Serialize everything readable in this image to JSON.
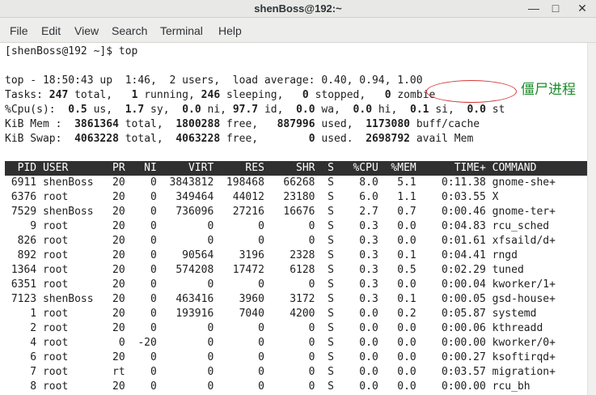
{
  "window": {
    "title": "shenBoss@192:~",
    "controls": {
      "minimize": "—",
      "maximize": "□",
      "close": "✕"
    }
  },
  "menu": [
    "File",
    "Edit",
    "View",
    "Search",
    "Terminal",
    "Help"
  ],
  "terminal": {
    "prompt_line": "[shenBoss@192 ~]$ top",
    "summary": {
      "line1": "top - 18:50:43 up  1:46,  2 users,  load average: 0.40, 0.94, 1.00",
      "tasks": {
        "label": "Tasks:",
        "total": "247",
        "total_label": "total,",
        "running": "1",
        "running_label": "running,",
        "sleeping": "246",
        "sleeping_label": "sleeping,",
        "stopped": "0",
        "stopped_label": "stopped,",
        "zombie": "0",
        "zombie_label": "zombie"
      },
      "cpu": {
        "label": "%Cpu(s):",
        "us": "0.5",
        "us_label": "us,",
        "sy": "1.7",
        "sy_label": "sy,",
        "ni": "0.0",
        "ni_label": "ni,",
        "id": "97.7",
        "id_label": "id,",
        "wa": "0.0",
        "wa_label": "wa,",
        "hi": "0.0",
        "hi_label": "hi,",
        "si": "0.1",
        "si_label": "si,",
        "st": "0.0",
        "st_label": "st"
      },
      "mem": {
        "label": "KiB Mem :",
        "total": "3861364",
        "total_label": "total,",
        "free": "1800288",
        "free_label": "free,",
        "used": "887996",
        "used_label": "used,",
        "buff": "1173080",
        "buff_label": "buff/cache"
      },
      "swap": {
        "label": "KiB Swap:",
        "total": "4063228",
        "total_label": "total,",
        "free": "4063228",
        "free_label": "free,",
        "used": "0",
        "used_label": "used.",
        "avail": "2698792",
        "avail_label": "avail Mem"
      }
    },
    "columns": [
      "PID",
      "USER",
      "PR",
      "NI",
      "VIRT",
      "RES",
      "SHR",
      "S",
      "%CPU",
      "%MEM",
      "TIME+",
      "COMMAND"
    ],
    "processes": [
      [
        "6911",
        "shenBoss",
        "20",
        "0",
        "3843812",
        "198468",
        "66268",
        "S",
        "8.0",
        "5.1",
        "0:11.38",
        "gnome-she+"
      ],
      [
        "6376",
        "root",
        "20",
        "0",
        "349464",
        "44012",
        "23180",
        "S",
        "6.0",
        "1.1",
        "0:03.55",
        "X"
      ],
      [
        "7529",
        "shenBoss",
        "20",
        "0",
        "736096",
        "27216",
        "16676",
        "S",
        "2.7",
        "0.7",
        "0:00.46",
        "gnome-ter+"
      ],
      [
        "9",
        "root",
        "20",
        "0",
        "0",
        "0",
        "0",
        "S",
        "0.3",
        "0.0",
        "0:04.83",
        "rcu_sched"
      ],
      [
        "826",
        "root",
        "20",
        "0",
        "0",
        "0",
        "0",
        "S",
        "0.3",
        "0.0",
        "0:01.61",
        "xfsaild/d+"
      ],
      [
        "892",
        "root",
        "20",
        "0",
        "90564",
        "3196",
        "2328",
        "S",
        "0.3",
        "0.1",
        "0:04.41",
        "rngd"
      ],
      [
        "1364",
        "root",
        "20",
        "0",
        "574208",
        "17472",
        "6128",
        "S",
        "0.3",
        "0.5",
        "0:02.29",
        "tuned"
      ],
      [
        "6351",
        "root",
        "20",
        "0",
        "0",
        "0",
        "0",
        "S",
        "0.3",
        "0.0",
        "0:00.04",
        "kworker/1+"
      ],
      [
        "7123",
        "shenBoss",
        "20",
        "0",
        "463416",
        "3960",
        "3172",
        "S",
        "0.3",
        "0.1",
        "0:00.05",
        "gsd-house+"
      ],
      [
        "1",
        "root",
        "20",
        "0",
        "193916",
        "7040",
        "4200",
        "S",
        "0.0",
        "0.2",
        "0:05.87",
        "systemd"
      ],
      [
        "2",
        "root",
        "20",
        "0",
        "0",
        "0",
        "0",
        "S",
        "0.0",
        "0.0",
        "0:00.06",
        "kthreadd"
      ],
      [
        "4",
        "root",
        "0",
        "-20",
        "0",
        "0",
        "0",
        "S",
        "0.0",
        "0.0",
        "0:00.00",
        "kworker/0+"
      ],
      [
        "6",
        "root",
        "20",
        "0",
        "0",
        "0",
        "0",
        "S",
        "0.0",
        "0.0",
        "0:00.27",
        "ksoftirqd+"
      ],
      [
        "7",
        "root",
        "rt",
        "0",
        "0",
        "0",
        "0",
        "S",
        "0.0",
        "0.0",
        "0:03.57",
        "migration+"
      ],
      [
        "8",
        "root",
        "20",
        "0",
        "0",
        "0",
        "0",
        "S",
        "0.0",
        "0.0",
        "0:00.00",
        "rcu_bh"
      ]
    ]
  },
  "annotation": {
    "text": "僵尸进程",
    "ellipse_color": "#d43a3a",
    "text_color": "#1c8c2b"
  }
}
